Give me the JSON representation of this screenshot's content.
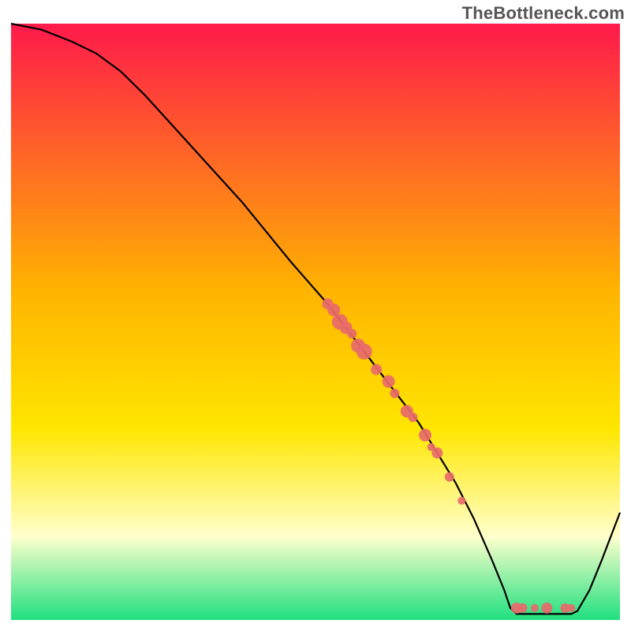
{
  "watermark": "TheBottleneck.com",
  "chart_data": {
    "type": "line",
    "title": "",
    "xlabel": "",
    "ylabel": "",
    "xlim": [
      0,
      100
    ],
    "ylim": [
      0,
      100
    ],
    "grid": false,
    "legend": false,
    "background_gradient": {
      "top": "#ff1a4b",
      "mid1": "#ffb400",
      "mid2": "#ffe600",
      "pale": "#ffffcc",
      "bottom": "#1fe07f"
    },
    "curve": [
      {
        "x": 0,
        "y": 100
      },
      {
        "x": 5,
        "y": 99
      },
      {
        "x": 10,
        "y": 97
      },
      {
        "x": 14,
        "y": 95
      },
      {
        "x": 18,
        "y": 92
      },
      {
        "x": 22,
        "y": 88
      },
      {
        "x": 30,
        "y": 79
      },
      {
        "x": 38,
        "y": 70
      },
      {
        "x": 46,
        "y": 60
      },
      {
        "x": 52,
        "y": 53
      },
      {
        "x": 55,
        "y": 49
      },
      {
        "x": 58,
        "y": 45
      },
      {
        "x": 61,
        "y": 41
      },
      {
        "x": 64,
        "y": 37
      },
      {
        "x": 67,
        "y": 33
      },
      {
        "x": 70,
        "y": 28
      },
      {
        "x": 73,
        "y": 23
      },
      {
        "x": 76,
        "y": 17
      },
      {
        "x": 79,
        "y": 10
      },
      {
        "x": 81,
        "y": 5
      },
      {
        "x": 82,
        "y": 2
      },
      {
        "x": 83,
        "y": 1
      },
      {
        "x": 86,
        "y": 1
      },
      {
        "x": 89,
        "y": 1
      },
      {
        "x": 92,
        "y": 1
      },
      {
        "x": 93,
        "y": 1.5
      },
      {
        "x": 95,
        "y": 5
      },
      {
        "x": 97,
        "y": 10
      },
      {
        "x": 100,
        "y": 18
      }
    ],
    "points": [
      {
        "x": 52,
        "y": 53,
        "size": 7
      },
      {
        "x": 53,
        "y": 52,
        "size": 8
      },
      {
        "x": 54,
        "y": 50,
        "size": 10
      },
      {
        "x": 55,
        "y": 49,
        "size": 8
      },
      {
        "x": 56,
        "y": 48,
        "size": 6
      },
      {
        "x": 57,
        "y": 46,
        "size": 9
      },
      {
        "x": 58,
        "y": 45,
        "size": 10
      },
      {
        "x": 60,
        "y": 42,
        "size": 7
      },
      {
        "x": 62,
        "y": 40,
        "size": 8
      },
      {
        "x": 63,
        "y": 38,
        "size": 6
      },
      {
        "x": 65,
        "y": 35,
        "size": 8
      },
      {
        "x": 66,
        "y": 34,
        "size": 6
      },
      {
        "x": 68,
        "y": 31,
        "size": 8
      },
      {
        "x": 69,
        "y": 29,
        "size": 5
      },
      {
        "x": 70,
        "y": 28,
        "size": 7
      },
      {
        "x": 72,
        "y": 24,
        "size": 6
      },
      {
        "x": 74,
        "y": 20,
        "size": 5
      },
      {
        "x": 83,
        "y": 2,
        "size": 7
      },
      {
        "x": 84,
        "y": 2,
        "size": 6
      },
      {
        "x": 86,
        "y": 2,
        "size": 5
      },
      {
        "x": 88,
        "y": 2,
        "size": 7
      },
      {
        "x": 91,
        "y": 2,
        "size": 6
      },
      {
        "x": 92,
        "y": 2,
        "size": 5
      }
    ],
    "point_color": "#e86a6a"
  }
}
